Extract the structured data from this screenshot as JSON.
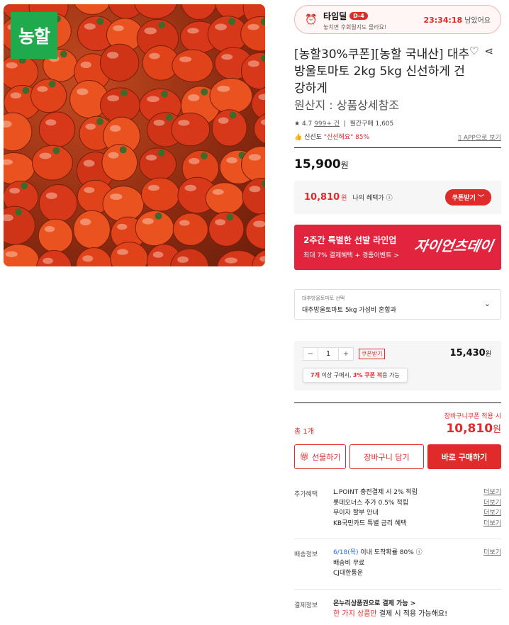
{
  "product": {
    "logo_text": "농할",
    "title": "[농할30%쿠폰][농할 국내산] 대추방울토마토 2kg 5kg 신선하게 건강하게",
    "origin": "원산지 : 상품상세참조",
    "rating": "4.7",
    "review_count": "999+ 건",
    "monthly_sales": "월간구매 1,605",
    "freshness_label": "신선도",
    "freshness_value": "\"신선해요\" 85%",
    "app_link": "APP으로 보기",
    "price": "15,900",
    "price_unit": "원"
  },
  "timedeal": {
    "title": "타임딜",
    "badge": "D-4",
    "subtitle": "놓치면 후회될지도 몰라요!",
    "time": "23:34:18",
    "time_suffix": "남았어요"
  },
  "benefit": {
    "price": "10,810",
    "unit": "원",
    "label": "나의 혜택가 ⓘ",
    "coupon_button": "쿠폰받기 ﹀"
  },
  "banner": {
    "title": "2주간 특별한 선발 라인업",
    "subtitle": "최대 7% 결제혜택 + 경품이벤트 >",
    "brand": "자이언츠데이"
  },
  "option": {
    "label": "대추방울토마토 선택",
    "value": "대추방울토마토 5kg 가성비 혼합과"
  },
  "quantity": {
    "value": "1",
    "coupon_tag": "쿠폰받기",
    "price": "15,430",
    "unit": "원",
    "tooltip_qty": "7개",
    "tooltip_mid": "이상 구매시,",
    "tooltip_pct": "3% 쿠폰 적",
    "tooltip_end": "용 가능"
  },
  "summary": {
    "cart_coupon": "장바구니쿠폰 적용 시",
    "total_label": "총 1개",
    "total_price": "10,810",
    "unit": "원"
  },
  "buttons": {
    "gift": "선물하기",
    "cart": "장바구니 담기",
    "buy": "바로 구매하기"
  },
  "extra": {
    "label": "추가혜택",
    "rows": [
      "L.POINT 충전결제 시 2% 적립",
      "롯데오너스 추가 0.5% 적립",
      "무이자 할부 안내",
      "KB국민카드 특별 금리 혜택"
    ],
    "more": "더보기"
  },
  "delivery": {
    "label": "배송정보",
    "date": "6/18(목)",
    "date_rest": "이내 도착확률 80% ⓘ",
    "fee": "배송비 무료",
    "carrier": "CJ대한통운",
    "more": "더보기"
  },
  "payment": {
    "label": "결제정보",
    "line1": "온누리상품권으로 결제 가능 >",
    "line2_red": "한 가지 상품만",
    "line2_rest": " 결제 시 적용 가능해요!"
  },
  "colors": {
    "accent": "#e12a2a",
    "logo": "#1fab4d",
    "banner": "#e3243f"
  }
}
